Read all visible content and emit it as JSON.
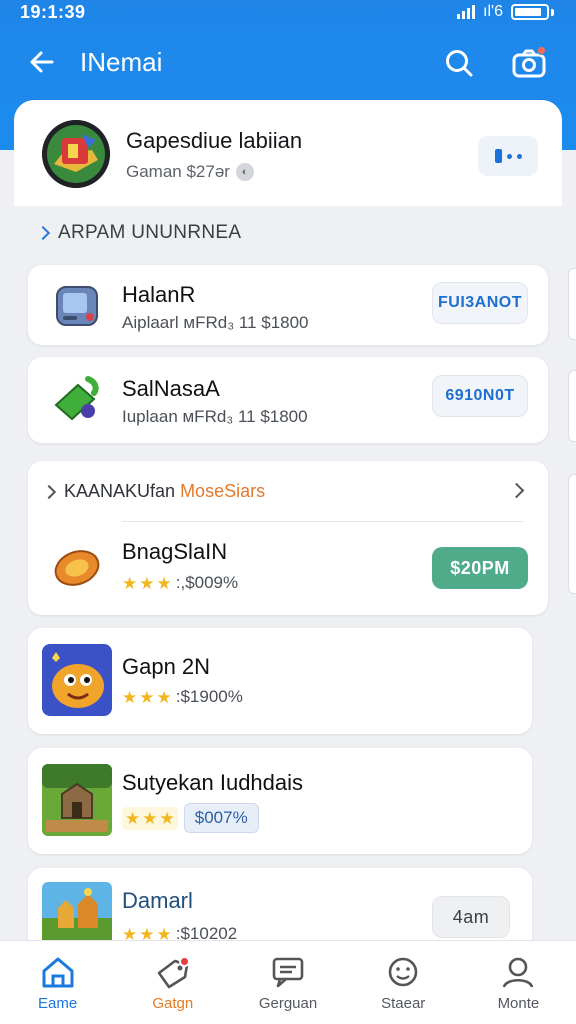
{
  "status_bar": {
    "time": "19:1:39",
    "network": "ıl'6"
  },
  "header": {
    "title": "INemai"
  },
  "profile": {
    "name": "Gapesdiue labiian",
    "subtitle": "Gaman $27ər"
  },
  "section1": {
    "title": "ARPAM UNUNRNEA"
  },
  "apps": [
    {
      "name": "HalanR",
      "detail": "Aiplaarl ᴍFRd₃ 11 $1800",
      "button": "FUI3ANOT"
    },
    {
      "name": "SalNasaA",
      "detail": "Iuplaan ᴍFRd₃ 11 $1800",
      "button": "6910N0T"
    }
  ],
  "section2": {
    "title_prefix": "KAANAKUfan ",
    "title_highlight": "MoseSiars",
    "title_color": "#e27a2c"
  },
  "games": [
    {
      "name": "BnagSlaIN",
      "rating": ":,$009%",
      "button": "$20PM"
    },
    {
      "name": "Gapn 2N",
      "rating": ":$1900%"
    },
    {
      "name": "Sutyekan Iudhdais",
      "rating": "$007%"
    },
    {
      "name": "Damarl",
      "rating": ":$10202",
      "button": "4am"
    }
  ],
  "nav": [
    {
      "label": "Eame"
    },
    {
      "label": "Gatgn"
    },
    {
      "label": "Gerguan"
    },
    {
      "label": "Staear"
    },
    {
      "label": "Monte"
    }
  ],
  "colors": {
    "primary": "#1c87ea",
    "accent_green": "#4fab8a",
    "accent_orange": "#e47b22"
  }
}
